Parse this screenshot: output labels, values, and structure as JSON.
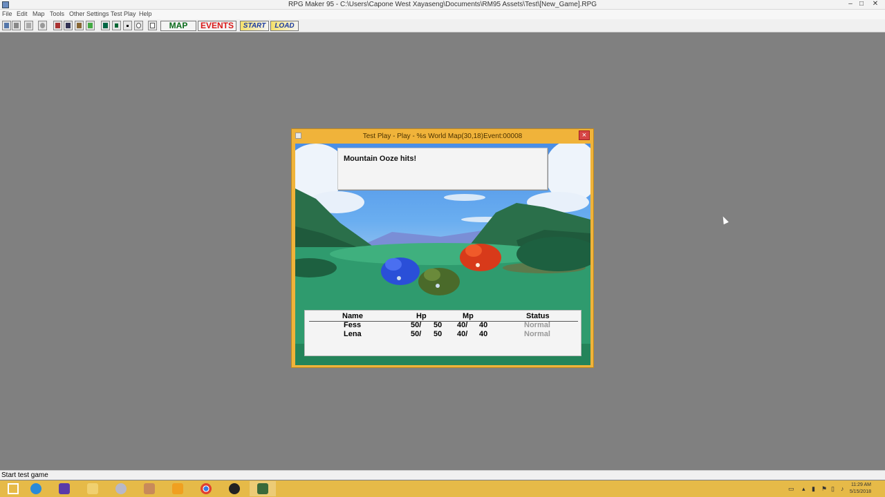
{
  "window": {
    "title": "RPG Maker 95 - C:\\Users\\Capone West Xayaseng\\Documents\\RM95 Assets\\Test\\[New_Game].RPG",
    "minimize": "–",
    "maximize": "□",
    "close": "✕"
  },
  "menu": [
    "File",
    "Edit",
    "Map",
    "Tools",
    "Other Settings",
    "Test Play",
    "Help"
  ],
  "toolbar": {
    "map_label": "MAP",
    "events_label": "EVENTS",
    "start_label": "START",
    "load_label": "LOAD",
    "colors": {
      "map": "#0a6a1a",
      "events": "#d81818",
      "start": "#1a3aa0",
      "load": "#1a3aa0"
    }
  },
  "test_play": {
    "title": "Test Play - Play - %s World Map(30,18)Event:00008",
    "close": "×",
    "message": "Mountain Ooze hits!",
    "status": {
      "headers": {
        "name": "Name",
        "hp": "Hp",
        "mp": "Mp",
        "status": "Status"
      },
      "rows": [
        {
          "name": "Fess",
          "hp": "50/",
          "hp_max": "50",
          "mp": "40/",
          "mp_max": "40",
          "status": "Normal"
        },
        {
          "name": "Lena",
          "hp": "50/",
          "hp_max": "50",
          "mp": "40/",
          "mp_max": "40",
          "status": "Normal"
        }
      ]
    }
  },
  "statusbar": {
    "text": "Start test game"
  },
  "taskbar": {
    "apps": [
      "windows-start-icon",
      "internet-explorer-icon",
      "settings-icon",
      "file-explorer-icon",
      "app-icon-1",
      "app-icon-2",
      "media-player-icon",
      "chrome-icon",
      "obs-icon",
      "rpg-maker-icon"
    ],
    "clock_time": "11:29 AM",
    "clock_date": "5/15/2018"
  }
}
